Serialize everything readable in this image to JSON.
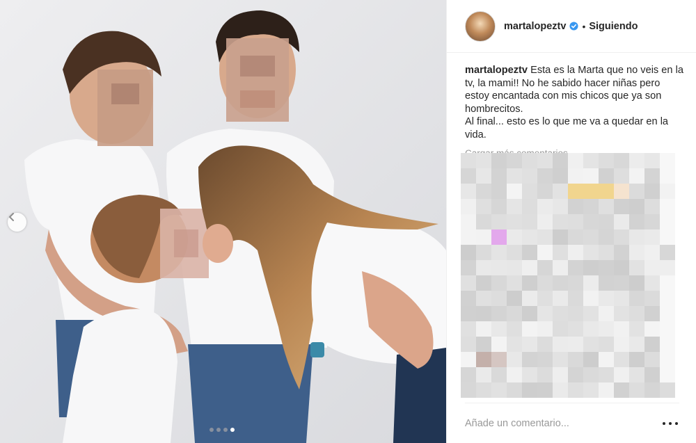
{
  "post": {
    "username": "martalopeztv",
    "verified_icon": "verified-badge-icon",
    "separator": "•",
    "follow_status": "Siguiendo",
    "caption_user": "martalopeztv",
    "caption_text": "Esta es la Marta que no veis en la tv, la mami!! No he sabido hacer niñas pero estoy encantada con mis chicos que ya son hombrecitos.",
    "caption_text_2": "Al final... esto es lo que me va a quedar en la vida.",
    "more_comments": "Cargar más comentarios",
    "comment_placeholder": "Añade un comentario...",
    "options_icon": "more-options-icon"
  },
  "carousel": {
    "prev_icon": "chevron-left-icon",
    "total_slides": 4,
    "active_slide": 4
  },
  "colors": {
    "verified": "#3897f0",
    "text": "#262626",
    "muted": "#999999",
    "divider": "#efefef"
  }
}
